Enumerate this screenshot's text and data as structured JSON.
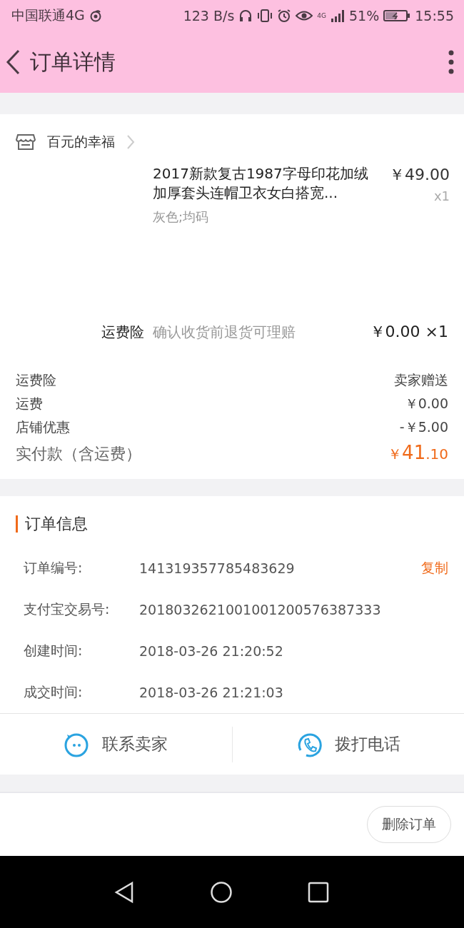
{
  "status_bar": {
    "carrier": "中国联通4G",
    "speed": "123 B/s",
    "network": "4G",
    "battery": "51%",
    "time": "15:55"
  },
  "header": {
    "title": "订单详情"
  },
  "shop": {
    "name": "百元的幸福"
  },
  "product": {
    "title": "2017新款复古1987字母印花加绒加厚套头连帽卫衣女白搭宽...",
    "price": "￥49.00",
    "quantity": "x1",
    "spec": "灰色;均码"
  },
  "insurance": {
    "label": "运费险",
    "description": "确认收货前退货可理赔",
    "price": "￥0.00 ×1"
  },
  "fees": [
    {
      "label": "运费险",
      "value": "卖家赠送"
    },
    {
      "label": "运费",
      "value": "￥0.00"
    },
    {
      "label": "店铺优惠",
      "value": "-￥5.00"
    }
  ],
  "total": {
    "label": "实付款（含运费）",
    "currency": "￥",
    "integer": "41",
    "decimal": ".10"
  },
  "order_info": {
    "title": "订单信息",
    "rows": [
      {
        "label": "订单编号:",
        "value": "141319357785483629",
        "action": "复制"
      },
      {
        "label": "支付宝交易号:",
        "value": "2018032621001001200576387333"
      },
      {
        "label": "创建时间:",
        "value": "2018-03-26 21:20:52"
      },
      {
        "label": "成交时间:",
        "value": "2018-03-26 21:21:03"
      }
    ]
  },
  "contact_actions": [
    {
      "kind": "chat",
      "label": "联系卖家"
    },
    {
      "kind": "phone",
      "label": "拨打电话"
    }
  ],
  "footer_buttons": [
    "删除订单"
  ]
}
